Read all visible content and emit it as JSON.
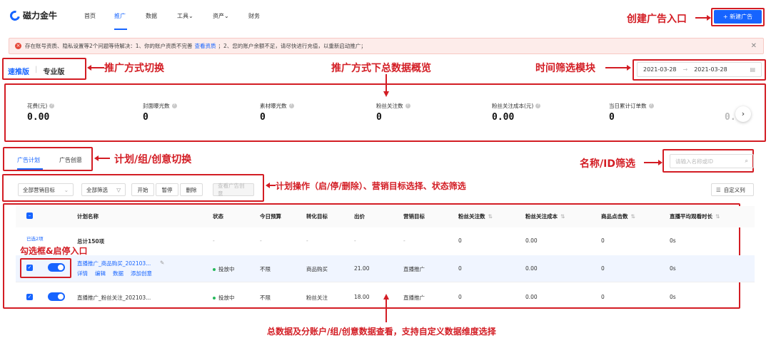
{
  "nav": {
    "logo": "磁力金牛",
    "items": [
      "首页",
      "推广",
      "数据",
      "工具⌄",
      "资产⌄",
      "财务"
    ],
    "new_ad_button": "+ 新建广告"
  },
  "notice": {
    "part1": "存在账号资质、隐私设置等2个问题等待解决：1、你的账户资质不完善",
    "link": "查看资质",
    "part2": "；2、您的账户余额不足，请尽快进行充值，以重新启动推广；"
  },
  "mode_tabs": {
    "quick": "速推版",
    "sep": "|",
    "pro": "专业版"
  },
  "date_range": {
    "start": "2021-03-28",
    "sep": "→",
    "end": "2021-03-28"
  },
  "kpis": [
    {
      "label": "花费(元)",
      "value": "0.00"
    },
    {
      "label": "封面曝光数",
      "value": "0"
    },
    {
      "label": "素材曝光数",
      "value": "0"
    },
    {
      "label": "粉丝关注数",
      "value": "0"
    },
    {
      "label": "粉丝关注成本(元)",
      "value": "0.00"
    },
    {
      "label": "当日累计订单数",
      "value": "0"
    },
    {
      "label": "",
      "value": "0."
    }
  ],
  "level_tabs": {
    "plan": "广告计划",
    "creative": "广告创意"
  },
  "search": {
    "placeholder": "请输入名称或ID"
  },
  "toolbar": {
    "goal": "全部营销目标",
    "filter": "全部筛选",
    "start": "开始",
    "pause": "暂停",
    "delete": "删除",
    "view_creative": "查看广告创意",
    "custom_columns": "自定义列"
  },
  "table": {
    "headers": [
      "计划名称",
      "状态",
      "今日预算",
      "转化目标",
      "出价",
      "营销目标",
      "粉丝关注数",
      "粉丝关注成本",
      "商品点击数",
      "直播平均观看时长"
    ],
    "selected": "已选2项",
    "total": {
      "name": "总计150项",
      "status": "-",
      "budget": "-",
      "target": "-",
      "bid": "-",
      "goal": "-",
      "fans": "0",
      "fans_cost": "0.00",
      "clicks": "0",
      "watch": "0s"
    },
    "rows": [
      {
        "name": "直播推广_商品购买_202103...",
        "actions": [
          "详情",
          "编辑",
          "数据",
          "添加创意"
        ],
        "status": "投放中",
        "budget": "不限",
        "target": "商品购买",
        "bid": "21.00",
        "goal": "直播推广",
        "fans": "0",
        "fans_cost": "0.00",
        "clicks": "0",
        "watch": "0s"
      },
      {
        "name": "直播推广_粉丝关注_202103...",
        "status": "投放中",
        "budget": "不限",
        "target": "粉丝关注",
        "bid": "18.00",
        "goal": "直播推广",
        "fans": "0",
        "fans_cost": "0.00",
        "clicks": "0",
        "watch": "0s"
      }
    ]
  },
  "annotations": {
    "create": "创建广告入口",
    "mode": "推广方式切换",
    "overview": "推广方式下总数据概览",
    "time": "时间筛选模块",
    "level": "计划/组/创意切换",
    "name_filter": "名称/ID筛选",
    "ops": "计划操作（启/停/删除）、营销目标选择、状态筛选",
    "checkbox": "勾选框&启停入口",
    "data": "总数据及分账户/组/创意数据查看，支持自定义数据维度选择"
  },
  "colors": {
    "primary": "#1664ff",
    "annotation": "#d31d24",
    "status_green": "#26b95c"
  }
}
